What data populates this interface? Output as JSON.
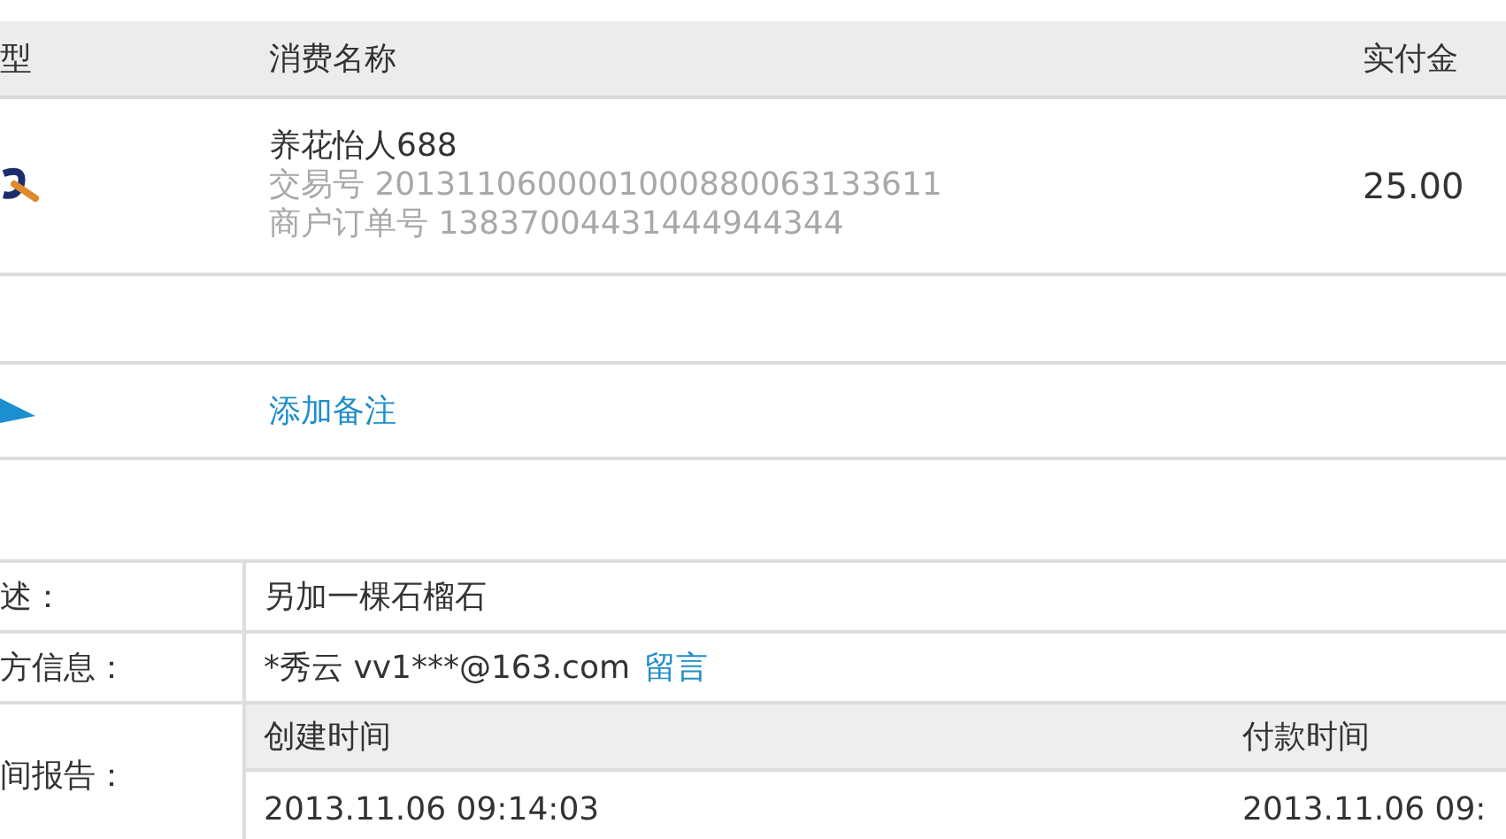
{
  "bill_table": {
    "columns": [
      "型",
      "消费名称",
      "实付金"
    ],
    "rows": [
      {
        "name": "养花怡人688",
        "trade_no": "交易号 2013110600001000880063133611",
        "order_no": "商户订单号 13837004431444944344",
        "amount": "25.00"
      }
    ],
    "note_link": "添加备注"
  },
  "details": {
    "description": {
      "label": "述：",
      "value": "另加一棵石榴石"
    },
    "counterparty": {
      "label": "方信息：",
      "value": "*秀云 vv1***@163.com",
      "link": "留言"
    },
    "time_report": {
      "label": "间报告：",
      "columns": [
        {
          "heading": "创建时间",
          "value": "2013.11.06 09:14:03"
        },
        {
          "heading": "付款时间",
          "value": "2013.11.06 09:"
        }
      ]
    }
  }
}
